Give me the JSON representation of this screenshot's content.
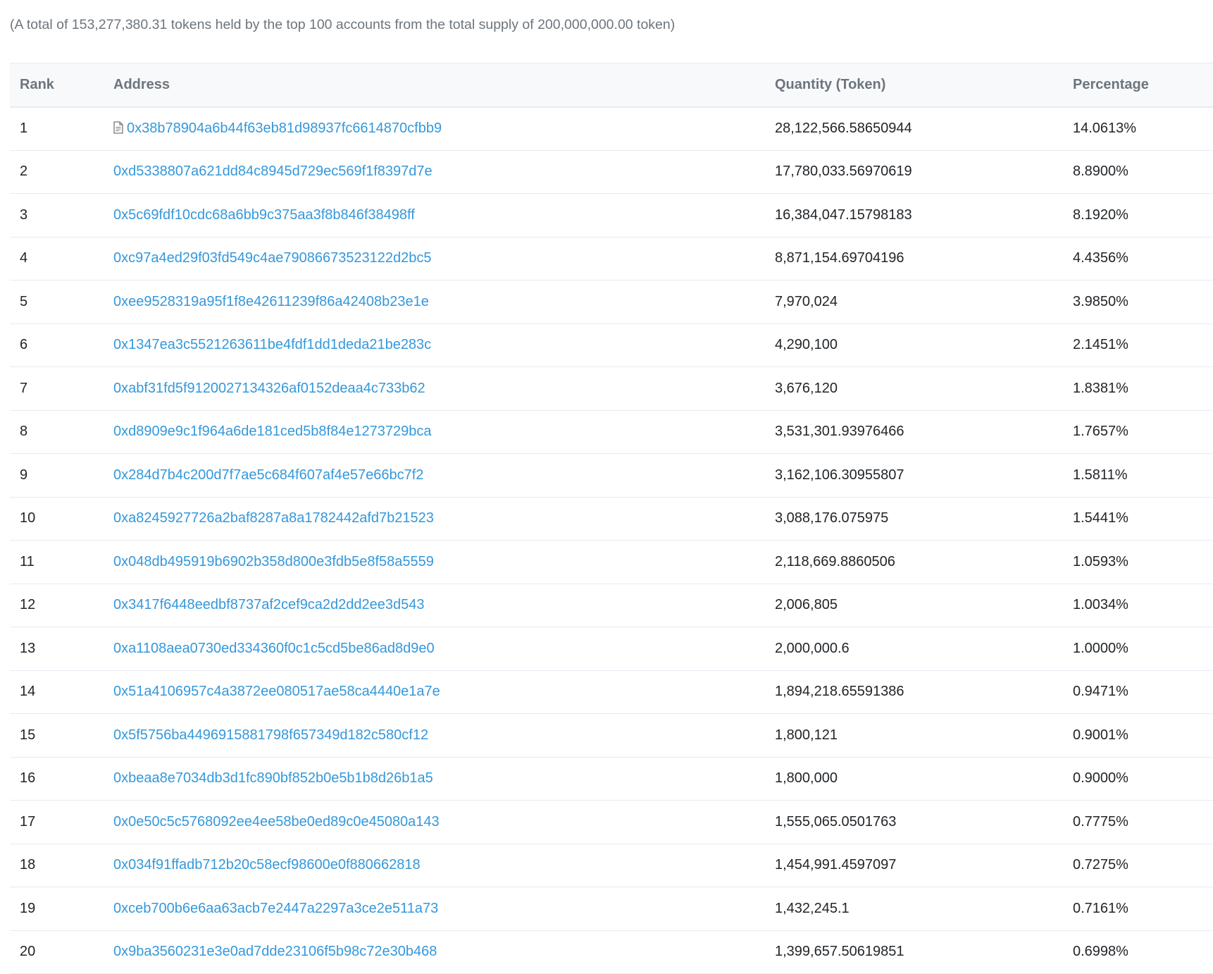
{
  "summary": {
    "text": "(A total of 153,277,380.31 tokens held by the top 100 accounts from the total supply of 200,000,000.00 token)"
  },
  "table": {
    "headers": {
      "rank": "Rank",
      "address": "Address",
      "quantity": "Quantity (Token)",
      "percentage": "Percentage"
    },
    "rows": [
      {
        "rank": "1",
        "address": "0x38b78904a6b44f63eb81d98937fc6614870cfbb9",
        "quantity": "28,122,566.58650944",
        "percentage": "14.0613%",
        "icon": "contract-document-icon"
      },
      {
        "rank": "2",
        "address": "0xd5338807a621dd84c8945d729ec569f1f8397d7e",
        "quantity": "17,780,033.56970619",
        "percentage": "8.8900%"
      },
      {
        "rank": "3",
        "address": "0x5c69fdf10cdc68a6bb9c375aa3f8b846f38498ff",
        "quantity": "16,384,047.15798183",
        "percentage": "8.1920%"
      },
      {
        "rank": "4",
        "address": "0xc97a4ed29f03fd549c4ae79086673523122d2bc5",
        "quantity": "8,871,154.69704196",
        "percentage": "4.4356%"
      },
      {
        "rank": "5",
        "address": "0xee9528319a95f1f8e42611239f86a42408b23e1e",
        "quantity": "7,970,024",
        "percentage": "3.9850%"
      },
      {
        "rank": "6",
        "address": "0x1347ea3c5521263611be4fdf1dd1deda21be283c",
        "quantity": "4,290,100",
        "percentage": "2.1451%"
      },
      {
        "rank": "7",
        "address": "0xabf31fd5f9120027134326af0152deaa4c733b62",
        "quantity": "3,676,120",
        "percentage": "1.8381%"
      },
      {
        "rank": "8",
        "address": "0xd8909e9c1f964a6de181ced5b8f84e1273729bca",
        "quantity": "3,531,301.93976466",
        "percentage": "1.7657%"
      },
      {
        "rank": "9",
        "address": "0x284d7b4c200d7f7ae5c684f607af4e57e66bc7f2",
        "quantity": "3,162,106.30955807",
        "percentage": "1.5811%"
      },
      {
        "rank": "10",
        "address": "0xa8245927726a2baf8287a8a1782442afd7b21523",
        "quantity": "3,088,176.075975",
        "percentage": "1.5441%"
      },
      {
        "rank": "11",
        "address": "0x048db495919b6902b358d800e3fdb5e8f58a5559",
        "quantity": "2,118,669.8860506",
        "percentage": "1.0593%"
      },
      {
        "rank": "12",
        "address": "0x3417f6448eedbf8737af2cef9ca2d2dd2ee3d543",
        "quantity": "2,006,805",
        "percentage": "1.0034%"
      },
      {
        "rank": "13",
        "address": "0xa1108aea0730ed334360f0c1c5cd5be86ad8d9e0",
        "quantity": "2,000,000.6",
        "percentage": "1.0000%"
      },
      {
        "rank": "14",
        "address": "0x51a4106957c4a3872ee080517ae58ca4440e1a7e",
        "quantity": "1,894,218.65591386",
        "percentage": "0.9471%"
      },
      {
        "rank": "15",
        "address": "0x5f5756ba4496915881798f657349d182c580cf12",
        "quantity": "1,800,121",
        "percentage": "0.9001%"
      },
      {
        "rank": "16",
        "address": "0xbeaa8e7034db3d1fc890bf852b0e5b1b8d26b1a5",
        "quantity": "1,800,000",
        "percentage": "0.9000%"
      },
      {
        "rank": "17",
        "address": "0x0e50c5c5768092ee4ee58be0ed89c0e45080a143",
        "quantity": "1,555,065.0501763",
        "percentage": "0.7775%"
      },
      {
        "rank": "18",
        "address": "0x034f91ffadb712b20c58ecf98600e0f880662818",
        "quantity": "1,454,991.4597097",
        "percentage": "0.7275%"
      },
      {
        "rank": "19",
        "address": "0xceb700b6e6aa63acb7e2447a2297a3ce2e511a73",
        "quantity": "1,432,245.1",
        "percentage": "0.7161%"
      },
      {
        "rank": "20",
        "address": "0x9ba3560231e3e0ad7dde23106f5b98c72e30b468",
        "quantity": "1,399,657.50619851",
        "percentage": "0.6998%"
      }
    ]
  },
  "colors": {
    "link": "#3498db",
    "header_bg": "#f8f9fa",
    "muted_text": "#6c757d",
    "border": "#e7eaf3"
  }
}
